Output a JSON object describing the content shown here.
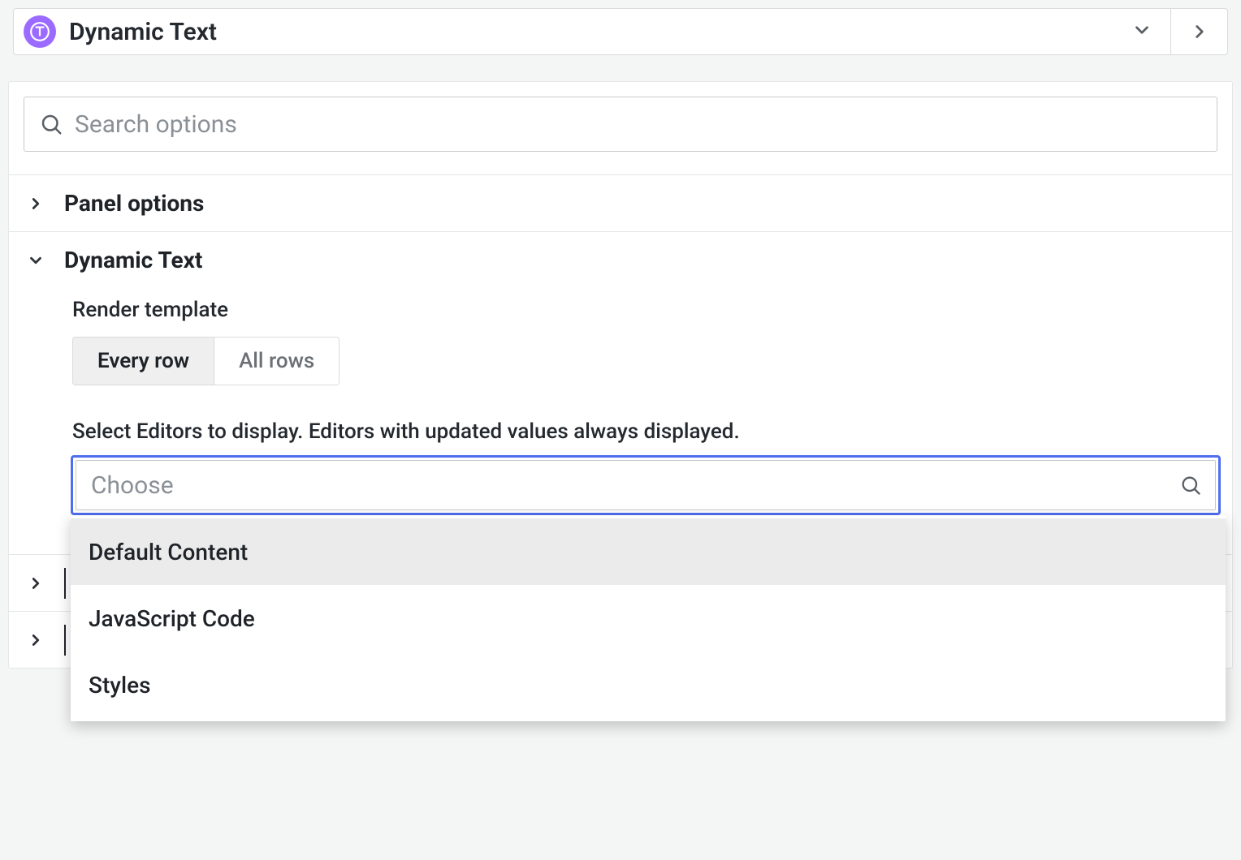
{
  "header": {
    "plugin_name": "Dynamic Text",
    "icon": "dynamic-text-plugin-icon"
  },
  "search": {
    "placeholder": "Search options"
  },
  "sections": {
    "panel_options": {
      "title": "Panel options",
      "expanded": false
    },
    "dynamic_text": {
      "title": "Dynamic Text",
      "expanded": true,
      "render_template": {
        "label": "Render template",
        "options": [
          "Every row",
          "All rows"
        ],
        "selected": "Every row"
      },
      "editors_select": {
        "label": "Select Editors to display. Editors with updated values always displayed.",
        "placeholder": "Choose",
        "options": [
          "Default Content",
          "JavaScript Code",
          "Styles"
        ],
        "highlighted_index": 0
      }
    }
  }
}
